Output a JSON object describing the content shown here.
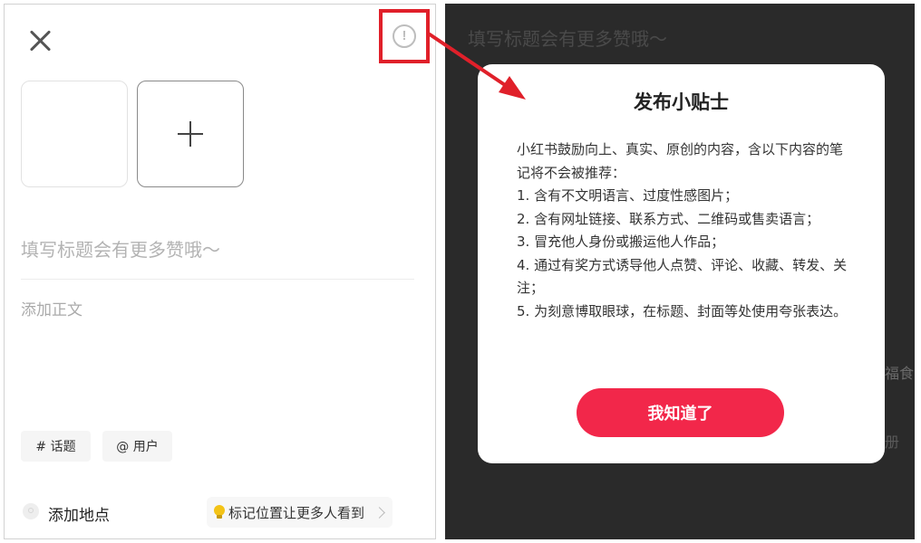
{
  "left": {
    "title_placeholder": "填写标题会有更多赞哦～",
    "body_placeholder": "添加正文",
    "chips": [
      {
        "label": "# 话题"
      },
      {
        "label": "@ 用户"
      }
    ],
    "location_label": "添加地点",
    "location_tip": "标记位置让更多人看到",
    "tips_glyph": "!"
  },
  "right": {
    "bg_title": "填写标题会有更多赞哦～",
    "bg_fragments": [
      "福食",
      "册"
    ],
    "dialog": {
      "title": "发布小贴士",
      "lines": [
        "小红书鼓励向上、真实、原创的内容，含以下内容的笔记将不会被推荐：",
        "1. 含有不文明语言、过度性感图片；",
        "2. 含有网址链接、联系方式、二维码或售卖语言；",
        "3. 冒充他人身份或搬运他人作品；",
        "4. 通过有奖方式诱导他人点赞、评论、收藏、转发、关注；",
        "5. 为刻意博取眼球，在标题、封面等处使用夸张表达。"
      ],
      "confirm_label": "我知道了"
    }
  },
  "colors": {
    "highlight": "#e0202a",
    "primary_button": "#f2274a",
    "overlay": "#2a2a2a"
  }
}
